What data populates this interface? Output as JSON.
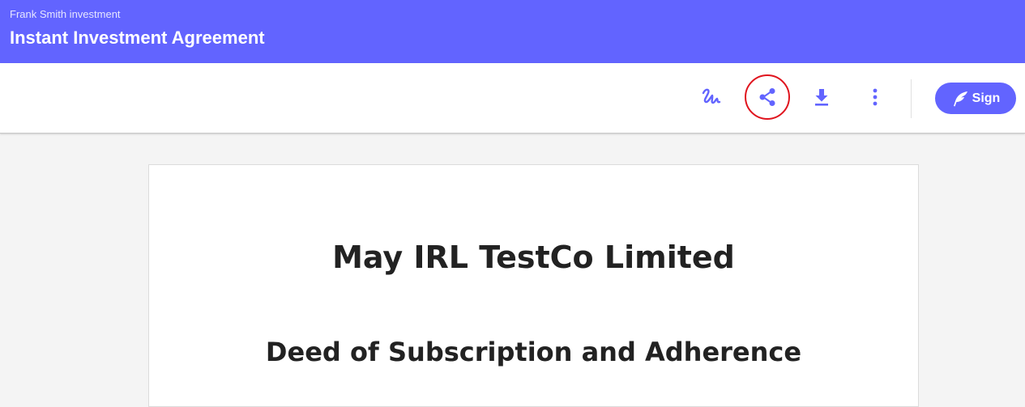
{
  "header": {
    "subtitle": "Frank Smith investment",
    "title": "Instant Investment Agreement"
  },
  "toolbar": {
    "buttons": [
      {
        "icon": "signature-icon"
      },
      {
        "icon": "share-icon",
        "highlighted": true
      },
      {
        "icon": "download-icon"
      },
      {
        "icon": "more-vert-icon"
      }
    ],
    "sign_label": "Sign",
    "sign_icon": "feather-icon"
  },
  "document": {
    "company": "May IRL TestCo Limited",
    "heading": "Deed of Subscription and Adherence"
  },
  "colors": {
    "accent": "#6264ff",
    "highlight_ring": "#e0141e",
    "background": "#f4f4f4"
  }
}
